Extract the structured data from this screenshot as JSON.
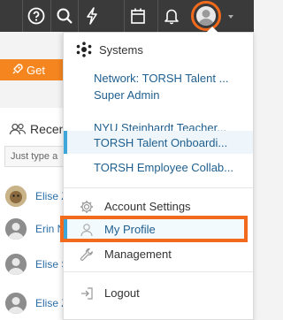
{
  "topbar": {
    "icons": [
      "help-icon",
      "search-icon",
      "lightning-icon",
      "calendar-icon",
      "bell-icon",
      "avatar-icon"
    ]
  },
  "background": {
    "get_started_label": "Get",
    "recent_title": "Recen",
    "recent_search_placeholder": "Just type a",
    "people": [
      {
        "name": "Elise Z",
        "avatar": "dog"
      },
      {
        "name": "Erin N",
        "avatar": "default"
      },
      {
        "name": "Elise S",
        "avatar": "default"
      },
      {
        "name": "Elise Z",
        "avatar": "default"
      }
    ]
  },
  "menu": {
    "systems_heading": "Systems",
    "systems": [
      {
        "label": "Network: TORSH Talent ...",
        "active": false
      },
      {
        "label": "Super Admin",
        "active": false
      },
      {
        "label": "NYU Steinhardt Teacher...",
        "active": false
      },
      {
        "label": "TORSH Talent Onboardi...",
        "active": true
      },
      {
        "label": "TORSH Employee Collab...",
        "active": false
      }
    ],
    "actions": {
      "account_settings": "Account Settings",
      "my_profile": "My Profile",
      "management": "Management",
      "logout": "Logout"
    }
  },
  "colors": {
    "topbar": "#3a3a3a",
    "highlight": "#f26a1b",
    "active_accent": "#3ea6d8",
    "link": "#1f5f8f"
  }
}
